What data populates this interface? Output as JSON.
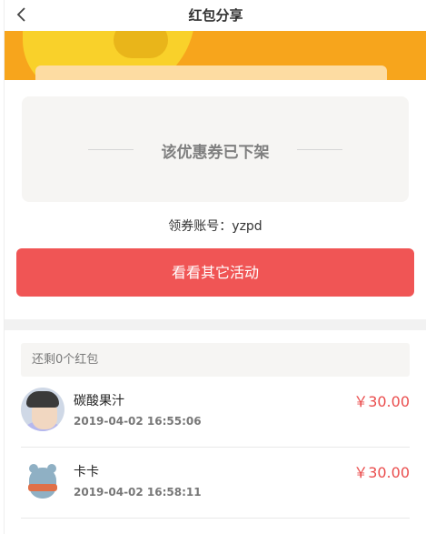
{
  "nav": {
    "title": "红包分享",
    "back_icon": "chevron-left-icon"
  },
  "coupon": {
    "status_text": "该优惠券已下架"
  },
  "account": {
    "label": "领券账号：yzpd"
  },
  "cta": {
    "label": "看看其它活动"
  },
  "summary": {
    "remaining_text": "还剩0个红包"
  },
  "records": [
    {
      "name": "碳酸果汁",
      "time": "2019-04-02 16:55:06",
      "amount": "￥30.00"
    },
    {
      "name": "卡卡",
      "time": "2019-04-02 16:58:11",
      "amount": "￥30.00"
    }
  ],
  "colors": {
    "accent": "#f05555",
    "amount": "#ea4d4d",
    "banner": "#f7a51c"
  }
}
